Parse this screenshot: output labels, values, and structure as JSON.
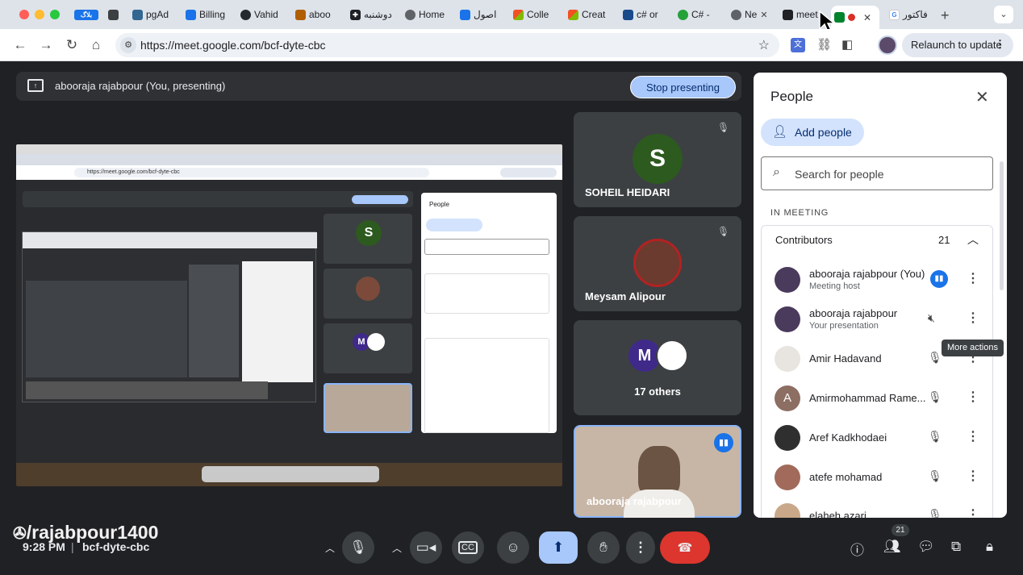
{
  "browser": {
    "tabs": [
      {
        "label": "بلاگ",
        "color": "#1a73e8"
      },
      {
        "label": "",
        "color": "#3c4043"
      },
      {
        "label": "pgAd",
        "color": "#336791"
      },
      {
        "label": "Billing",
        "color": "#1a73e8"
      },
      {
        "label": "Vahid",
        "color": "#24292f"
      },
      {
        "label": "aboo",
        "color": "#b06000"
      },
      {
        "label": "دوشنبه",
        "color": "#202124"
      },
      {
        "label": "Home",
        "color": "#5f6368"
      },
      {
        "label": "اصول",
        "color": "#1a73e8"
      },
      {
        "label": "Colle",
        "color": "#f25022"
      },
      {
        "label": "Creat",
        "color": "#f25022"
      },
      {
        "label": "c# or",
        "color": "#1a4a8a"
      },
      {
        "label": "C# -",
        "color": "#25a13a"
      },
      {
        "label": "Ne",
        "color": "#5f6368"
      },
      {
        "label": "meet",
        "color": "#202124"
      },
      {
        "label": "",
        "color": "#00832d"
      },
      {
        "label": "فاکتور",
        "color": "#4285f4"
      }
    ],
    "url": "https://meet.google.com/bcf-dyte-cbc",
    "relaunch_label": "Relaunch to update"
  },
  "meet": {
    "presenting_name": "abooraja rajabpour (You, presenting)",
    "stop_presenting": "Stop presenting",
    "tiles": [
      {
        "name": "SOHEIL HEIDARI",
        "initial": "S",
        "avatar_color": "#2d5a1f"
      },
      {
        "name": "Meysam Alipour"
      },
      {
        "name": "17 others",
        "initial": "M",
        "avatar_color": "#3f2a8a"
      },
      {
        "name": "abooraja rajabpour"
      }
    ],
    "time": "9:28 PM",
    "meeting_code": "bcf-dyte-cbc",
    "participant_count": "21",
    "watermark": "/rajabpour1400"
  },
  "people": {
    "title": "People",
    "add_people": "Add people",
    "search_placeholder": "Search for people",
    "in_meeting": "IN MEETING",
    "contributors_label": "Contributors",
    "contributors_count": "21",
    "tooltip": "More actions",
    "participants": [
      {
        "name": "abooraja rajabpour (You)",
        "role": "Meeting host"
      },
      {
        "name": "abooraja rajabpour",
        "role": "Your presentation"
      },
      {
        "name": "Amir Hadavand",
        "role": ""
      },
      {
        "name": "Amirmohammad Rame...",
        "role": "",
        "initial": "A"
      },
      {
        "name": "Aref Kadkhodaei",
        "role": ""
      },
      {
        "name": "atefe mohamad",
        "role": ""
      },
      {
        "name": "elaheh azari",
        "role": ""
      }
    ]
  }
}
